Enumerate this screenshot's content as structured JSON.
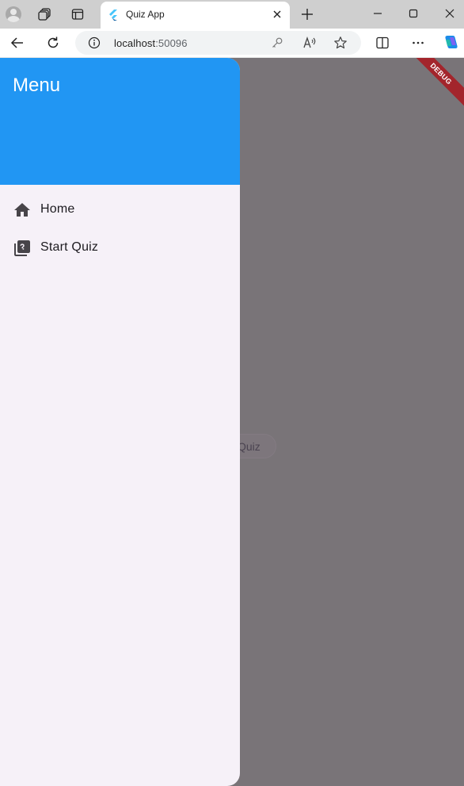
{
  "browser": {
    "tab": {
      "title": "Quiz App"
    },
    "address": {
      "host": "localhost",
      "port": ":50096"
    },
    "icons": {
      "profile": "profile-avatar-icon",
      "workspaces": "workspaces-icon",
      "tab_actions": "tab-actions-icon",
      "favicon": "flutter-icon",
      "tab_close": "close-icon",
      "new_tab": "plus-icon",
      "minimize": "minimize-icon",
      "maximize": "maximize-icon",
      "close_window": "close-icon",
      "back": "arrow-left-icon",
      "reload": "refresh-icon",
      "site_info": "info-icon",
      "passwords": "key-icon",
      "read_aloud": "read-aloud-icon",
      "favorites": "star-icon",
      "split_screen": "split-screen-icon",
      "more": "more-dots-icon",
      "copilot": "copilot-icon"
    }
  },
  "app": {
    "debug_banner": "DEBUG",
    "background_button": {
      "label": "Quiz"
    },
    "drawer": {
      "header": {
        "title": "Menu",
        "color": "#2196f3"
      },
      "items": [
        {
          "label": "Home",
          "icon": "home-icon"
        },
        {
          "label": "Start Quiz",
          "icon": "quiz-icon"
        }
      ]
    },
    "colors": {
      "scrim": "#797478",
      "drawer_bg": "#f6f1f8",
      "header": "#2196f3",
      "debug": "#a3252c"
    }
  }
}
